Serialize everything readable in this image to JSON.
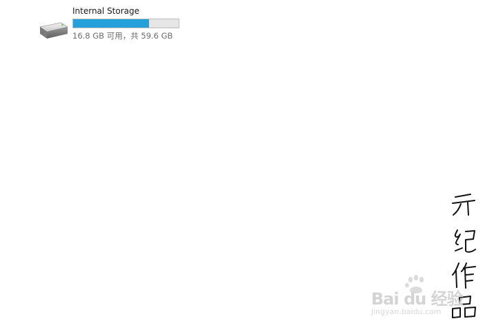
{
  "drive": {
    "name": "Internal Storage",
    "icon": "hard-drive-icon",
    "used_fraction": 0.72,
    "space_text": "16.8 GB 可用，共 59.6 GB",
    "bar_fill_color": "#26a0da",
    "bar_track_color": "#e6e6e6"
  },
  "signature": {
    "text": "亓纪作品"
  },
  "watermark": {
    "main": "Bai du 经验",
    "sub": "jingyan.baidu.com"
  }
}
